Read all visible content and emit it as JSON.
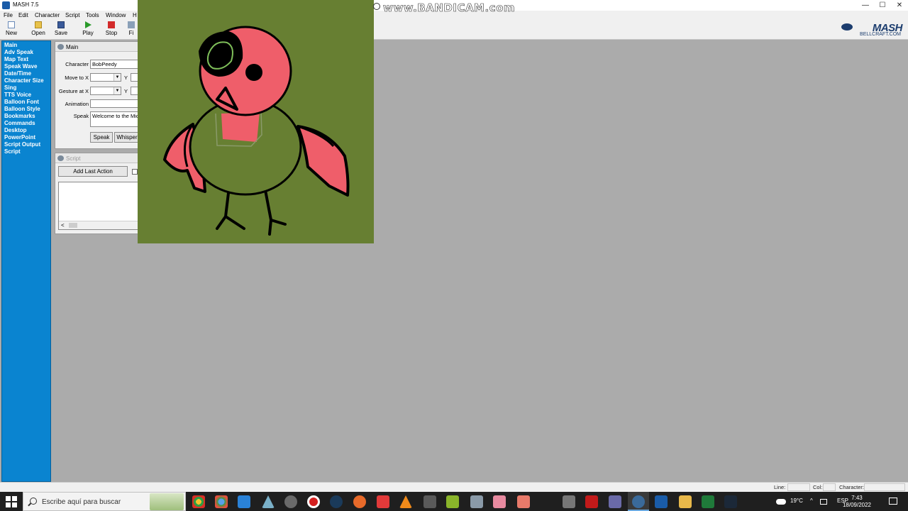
{
  "window": {
    "title": "MASH 7.5",
    "controls": [
      "—",
      "☐",
      "✕"
    ],
    "overlay_watermark": "www.BANDICAM.com"
  },
  "menu": [
    "File",
    "Edit",
    "Character",
    "Script",
    "Tools",
    "Window",
    "H"
  ],
  "toolbar": [
    {
      "label": "New",
      "icon": "new-document-icon"
    },
    {
      "label": "Open",
      "icon": "open-folder-icon"
    },
    {
      "label": "Save",
      "icon": "save-disk-icon"
    },
    {
      "label": "Play",
      "icon": "play-icon"
    },
    {
      "label": "Stop",
      "icon": "stop-icon"
    },
    {
      "label": "Fi",
      "icon": "find-icon"
    }
  ],
  "logo": {
    "name": "MASH",
    "sub": "BELLCRAFT.COM"
  },
  "sidebar": [
    "Main",
    "Adv Speak",
    "Map Text",
    "Speak Wave",
    "Date/Time",
    "Character Size",
    "Sing",
    "TTS Voice",
    "Balloon Font",
    "Balloon Style",
    "Bookmarks",
    "Commands",
    "Desktop",
    "PowerPoint",
    "Script Output",
    "Script"
  ],
  "main_panel": {
    "title": "Main",
    "character_label": "Character",
    "character_value": "BobPeedy",
    "move_to_label": "Move to X",
    "gesture_at_label": "Gesture at X",
    "y_label": "Y",
    "animation_label": "Animation",
    "speak_label": "Speak",
    "speak_value": "Welcome to the Micr",
    "speak_button": "Speak",
    "whisper_button": "Whisper"
  },
  "script_panel": {
    "title": "Script",
    "add_last_action": "Add Last Action",
    "scroll_left": "<"
  },
  "statusbar": {
    "line": "Line:",
    "col": "Col:",
    "character": "Character:"
  },
  "taskbar": {
    "search_placeholder": "Escribe aquí para buscar",
    "weather": "19°C",
    "language": "ESP",
    "time": "7:43",
    "date": "18/09/2022"
  },
  "colors": {
    "sidebar": "#0a84d0",
    "canvas": "#677f32",
    "bird_body_pink": "#ef5e6a",
    "workspace": "#ababab"
  }
}
